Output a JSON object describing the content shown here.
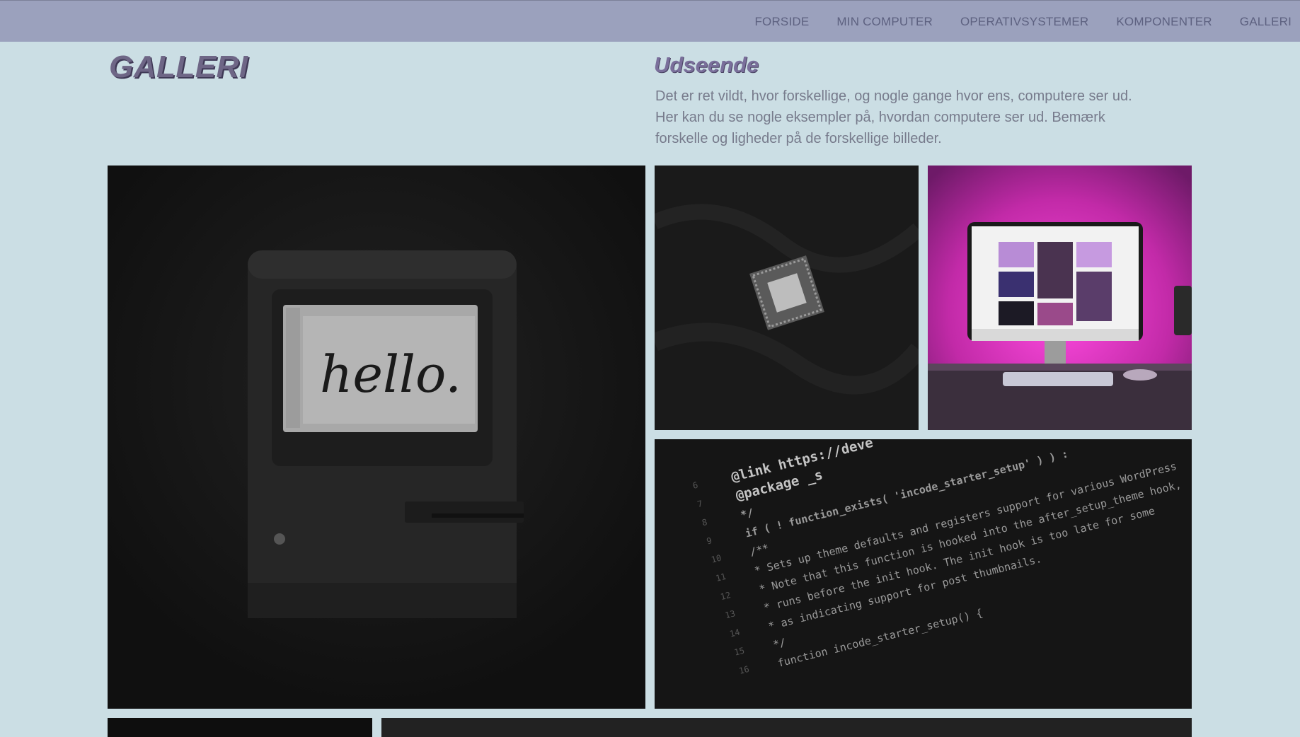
{
  "nav": {
    "items": [
      {
        "label": "FORSIDE"
      },
      {
        "label": "MIN COMPUTER"
      },
      {
        "label": "OPERATIVSYSTEMER"
      },
      {
        "label": "KOMPONENTER"
      },
      {
        "label": "GALLERI"
      }
    ]
  },
  "page": {
    "title": "GALLERI"
  },
  "section": {
    "title": "Udseende",
    "description": "Det er ret vildt, hvor forskellige, og nogle gange hvor ens, computere ser ud. Her kan du se nogle eksempler på, hvordan computere ser ud. Bemærk forskelle og ligheder på de forskellige billeder."
  },
  "gallery": {
    "mac_screen_text": "hello.",
    "code_lines": [
      "@link https://deve",
      "@package _s",
      "*/",
      "if ( ! function_exists( 'incode_starter_setup' ) ) :",
      "/**",
      " * Sets up theme defaults and registers support for various WordPress",
      " * Note that this function is hooked into the after_setup_theme hook,",
      " * runs before the init hook. The init hook is too late for some",
      " * as indicating support for post thumbnails.",
      " */",
      "function incode_starter_setup() {"
    ],
    "line_numbers": [
      "6",
      "7",
      "8",
      "9",
      "10",
      "11",
      "12",
      "13",
      "14",
      "15",
      "16"
    ]
  },
  "colors": {
    "background": "#cbdee4",
    "topbar": "#9ba1bd",
    "nav_text": "#5d6180",
    "title": "#6e6686",
    "accent_magenta": "#d23cc0"
  }
}
